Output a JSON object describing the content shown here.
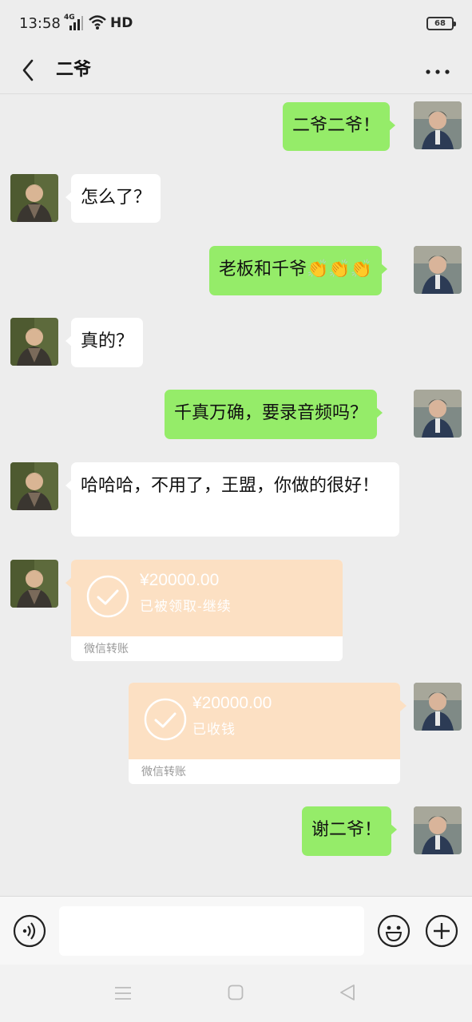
{
  "status_bar": {
    "time": "13:58",
    "network": "4G",
    "hd": "HD",
    "battery": "68"
  },
  "header": {
    "title": "二爷"
  },
  "messages": [
    {
      "side": "me",
      "text": "二爷二爷！"
    },
    {
      "side": "other",
      "text": "怎么了？"
    },
    {
      "side": "me",
      "text": "老板和千爷",
      "emoji": "👏👏👏"
    },
    {
      "side": "other",
      "text": "真的？"
    },
    {
      "side": "me",
      "text": "千真万确，要录音频吗？"
    },
    {
      "side": "other",
      "text": "哈哈哈，不用了，王盟，你做的很好！"
    },
    {
      "side": "other",
      "type": "transfer",
      "amount": "¥20000.00",
      "status": "已被领取-继续",
      "footer": "微信转账"
    },
    {
      "side": "me",
      "type": "transfer",
      "amount": "¥20000.00",
      "status": "已收钱",
      "footer": "微信转账"
    },
    {
      "side": "me",
      "text": "谢二爷！"
    }
  ],
  "input": {
    "placeholder": ""
  },
  "colors": {
    "my_bubble": "#95ec69",
    "other_bubble": "#ffffff",
    "transfer": "#fce0c3",
    "background": "#ededed"
  },
  "icons": [
    "back-icon",
    "more-icon",
    "voice-icon",
    "emoji-icon",
    "plus-icon",
    "check-circle-icon",
    "menu-icon",
    "home-icon",
    "back-triangle-icon"
  ]
}
